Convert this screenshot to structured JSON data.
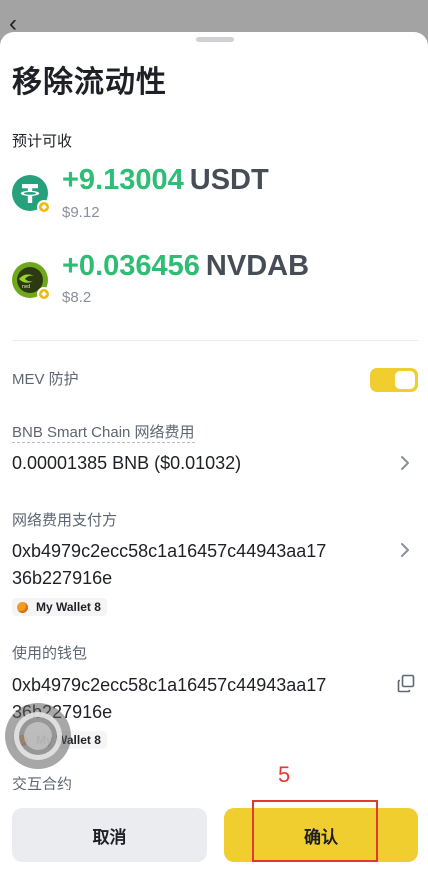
{
  "overlay": {
    "back_icon": "chevron-left-icon",
    "back_glyph": "‹"
  },
  "sheet": {
    "title": "移除流动性",
    "receive_label": "预计可收",
    "tokens": [
      {
        "amount": "+9.13004",
        "symbol": "USDT",
        "fiat": "$9.12",
        "icon": "usdt-icon"
      },
      {
        "amount": "+0.036456",
        "symbol": "NVDAB",
        "fiat": "$8.2",
        "icon": "nvdab-icon"
      }
    ],
    "mev": {
      "label": "MEV 防护",
      "enabled": true
    },
    "fee": {
      "label": "BNB Smart Chain 网络费用",
      "value": "0.00001385 BNB ($0.01032)"
    },
    "payer": {
      "label": "网络费用支付方",
      "address": "0xb4979c2ecc58c1a16457c44943aa1736b227916e",
      "wallet": "My Wallet 8"
    },
    "wallet_used": {
      "label": "使用的钱包",
      "address": "0xb4979c2ecc58c1a16457c44943aa1736b227916e",
      "wallet": "My Wallet 8"
    },
    "contract": {
      "label": "交互合约"
    }
  },
  "buttons": {
    "cancel": "取消",
    "confirm": "确认"
  },
  "annotation": {
    "step": "5"
  },
  "colors": {
    "accent_yellow": "#F0CE30",
    "positive_green": "#2EBD74",
    "cancel_gray": "#EAECEF",
    "annotation_red": "#E5392F",
    "overlay_gray": "#A3A3A3"
  },
  "icons": [
    "chevron-left-icon",
    "usdt-icon",
    "nvdab-icon",
    "bnb-chain-badge-icon",
    "chevron-right-icon",
    "copy-icon",
    "wallet-avatar-icon",
    "assistive-touch-icon",
    "floating-assistant-icon"
  ]
}
